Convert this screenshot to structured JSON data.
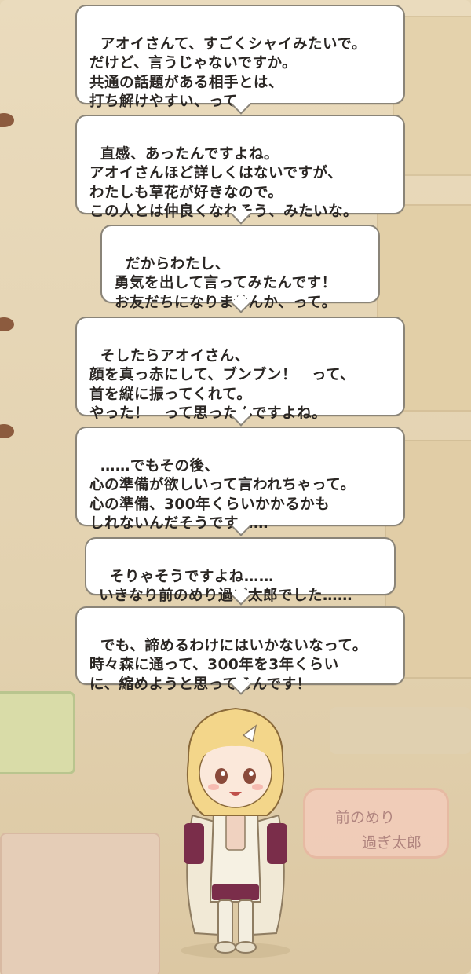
{
  "dialogue": [
    "アオイさんて、すごくシャイみたいで。\nだけど、言うじゃないですか。\n共通の話題がある相手とは、\n打ち解けやすい、って。",
    "直感、あったんですよね。\nアオイさんほど詳しくはないですが、\nわたしも草花が好きなので。\nこの人とは仲良くなれそう、みたいな。",
    "だからわたし、\n勇気を出して言ってみたんです！\nお友だちになりませんか、って。",
    "そしたらアオイさん、\n顔を真っ赤にして、ブンブン！　って、\n首を縦に振ってくれて。\nやった！　って思ったんですよね。",
    "……でもその後、\n心の準備が欲しいって言われちゃって。\n心の準備、300年くらいかかるかも\nしれないんだそうです……",
    "そりゃそうですよね……\nいきなり前のめり過ぎ太郎でした……",
    "でも、諦めるわけにはいかないなって。\n時々森に通って、300年を3年くらい\nに、縮めようと思ってるんです！"
  ],
  "background_sign": {
    "line1": "前のめり",
    "line2": "過ぎ太郎"
  },
  "colors": {
    "background": "#e6d6b6",
    "bubble_border": "#8a8478",
    "bubble_fill": "#ffffff",
    "text": "#2a2623"
  },
  "character": {
    "hair_color": "#f3d68a",
    "outfit_color": "#f5efdf",
    "accent_color": "#7a2d4a"
  }
}
